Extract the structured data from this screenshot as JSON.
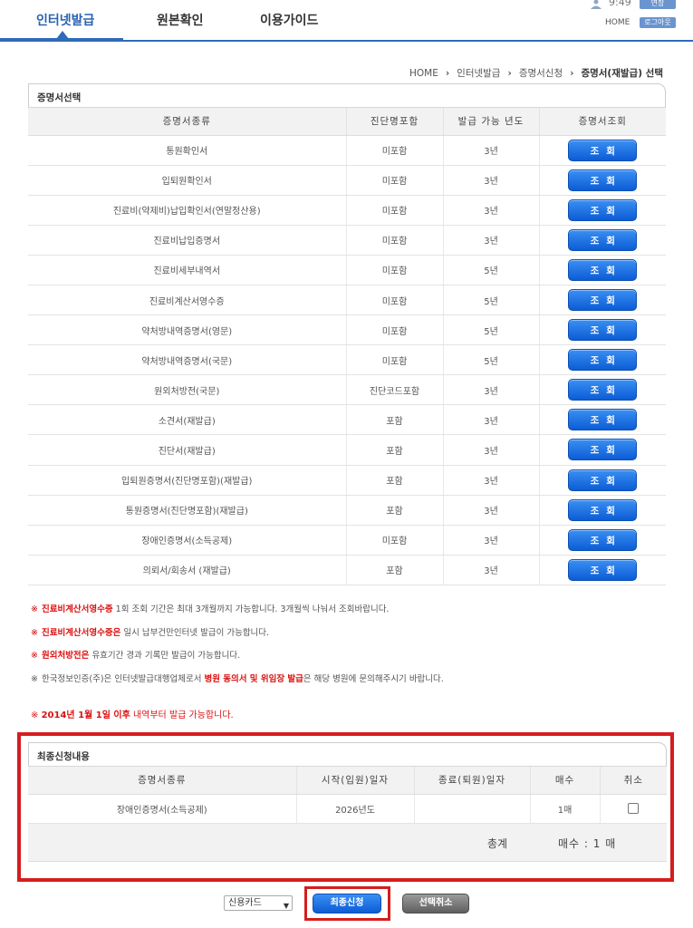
{
  "nav": {
    "tabs": [
      {
        "label": "인터넷발급",
        "active": true
      },
      {
        "label": "원본확인",
        "active": false
      },
      {
        "label": "이용가이드",
        "active": false
      }
    ]
  },
  "header": {
    "time": "9:49",
    "extend_label": "연장",
    "home_label": "HOME",
    "logout_label": "로그아웃"
  },
  "breadcrumb": [
    "HOME",
    "인터넷발급",
    "증명서신청",
    "증명서(재발급) 선택"
  ],
  "cert_section": {
    "title": "증명서선택",
    "columns": [
      "증명서종류",
      "진단명포함",
      "발급 가능 년도",
      "증명서조회"
    ],
    "lookup_label": "조회",
    "rows": [
      {
        "name": "통원확인서",
        "diagnosis": "미포함",
        "years": "3년"
      },
      {
        "name": "입퇴원확인서",
        "diagnosis": "미포함",
        "years": "3년"
      },
      {
        "name": "진료비(약제비)납입확인서(연말정산용)",
        "diagnosis": "미포함",
        "years": "3년"
      },
      {
        "name": "진료비납입증명서",
        "diagnosis": "미포함",
        "years": "3년"
      },
      {
        "name": "진료비세부내역서",
        "diagnosis": "미포함",
        "years": "5년"
      },
      {
        "name": "진료비계산서영수증",
        "diagnosis": "미포함",
        "years": "5년"
      },
      {
        "name": "약처방내역증명서(영문)",
        "diagnosis": "미포함",
        "years": "5년"
      },
      {
        "name": "약처방내역증명서(국문)",
        "diagnosis": "미포함",
        "years": "5년"
      },
      {
        "name": "원외처방전(국문)",
        "diagnosis": "진단코드포함",
        "years": "3년"
      },
      {
        "name": "소견서(재발급)",
        "diagnosis": "포함",
        "years": "3년"
      },
      {
        "name": "진단서(재발급)",
        "diagnosis": "포함",
        "years": "3년"
      },
      {
        "name": "입퇴원증명서(진단명포함)(재발급)",
        "diagnosis": "포함",
        "years": "3년"
      },
      {
        "name": "통원증명서(진단명포함)(재발급)",
        "diagnosis": "포함",
        "years": "3년"
      },
      {
        "name": "장애인증명서(소득공제)",
        "diagnosis": "미포함",
        "years": "3년"
      },
      {
        "name": "의뢰서/회송서 (재발급)",
        "diagnosis": "포함",
        "years": "3년"
      }
    ]
  },
  "notes": {
    "mark": "※",
    "line1_em": "진료비계산서영수증",
    "line1_rest": " 1회 조회 기간은 최대 3개월까지 가능합니다. 3개월씩 나눠서 조회바랍니다.",
    "line2_em": "진료비계산서영수증은",
    "line2_rest": " 일시 납부건만인터넷 발급이 가능합니다.",
    "line3_em": "원외처방전은",
    "line3_rest": " 유효기간 경과 기록만 발급이 가능합니다.",
    "line4_a": "한국정보인증(주)은 인터넷발급대행업체로서 ",
    "line4_em": "병원 동의서 및 위임장 발급",
    "line4_b": "은 해당 병원에 문의해주시기 바랍니다.",
    "date_mark": "※",
    "date_em": "2014년 1월 1일 이후",
    "date_rest": " 내역부터 발급 가능합니다."
  },
  "final_section": {
    "title": "최종신청내용",
    "columns": [
      "증명서종류",
      "시작(입원)일자",
      "종료(퇴원)일자",
      "매수",
      "취소"
    ],
    "rows": [
      {
        "name": "장애인증명서(소득공제)",
        "start": "2026년도",
        "end": "",
        "count": "1매"
      }
    ],
    "total_label": "총계",
    "total_count": "매수 :  1 매"
  },
  "controls": {
    "payment_selected": "신용카드",
    "submit_label": "최종신청",
    "cancel_label": "선택취소"
  },
  "colors": {
    "accent": "#2f6bb8",
    "button_blue": "#0c5cd6",
    "highlight_red": "#d51d1d"
  }
}
